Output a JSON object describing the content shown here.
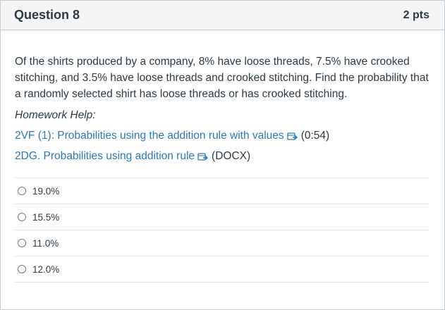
{
  "question": {
    "title": "Question 8",
    "points": "2 pts",
    "text": "Of the shirts produced by a company, 8% have loose threads, 7.5% have crooked stitching, and 3.5% have loose threads and crooked stitching. Find the probability that a randomly selected shirt has loose threads or has crooked stitching."
  },
  "homework_help": {
    "label": "Homework Help:",
    "links": [
      {
        "text": "2VF (1): Probabilities using the addition rule with values",
        "suffix": "(0:54)",
        "icon": "external-link-icon"
      },
      {
        "text": "2DG. Probabilities using addition rule",
        "suffix": "(DOCX)",
        "icon": "external-link-icon"
      }
    ]
  },
  "answers": [
    {
      "label": "19.0%",
      "selected": false
    },
    {
      "label": "15.5%",
      "selected": false
    },
    {
      "label": "11.0%",
      "selected": false
    },
    {
      "label": "12.0%",
      "selected": false
    }
  ],
  "colors": {
    "link": "#2b7abc",
    "header_bg": "#f5f5f5",
    "text": "#2d3b45"
  }
}
